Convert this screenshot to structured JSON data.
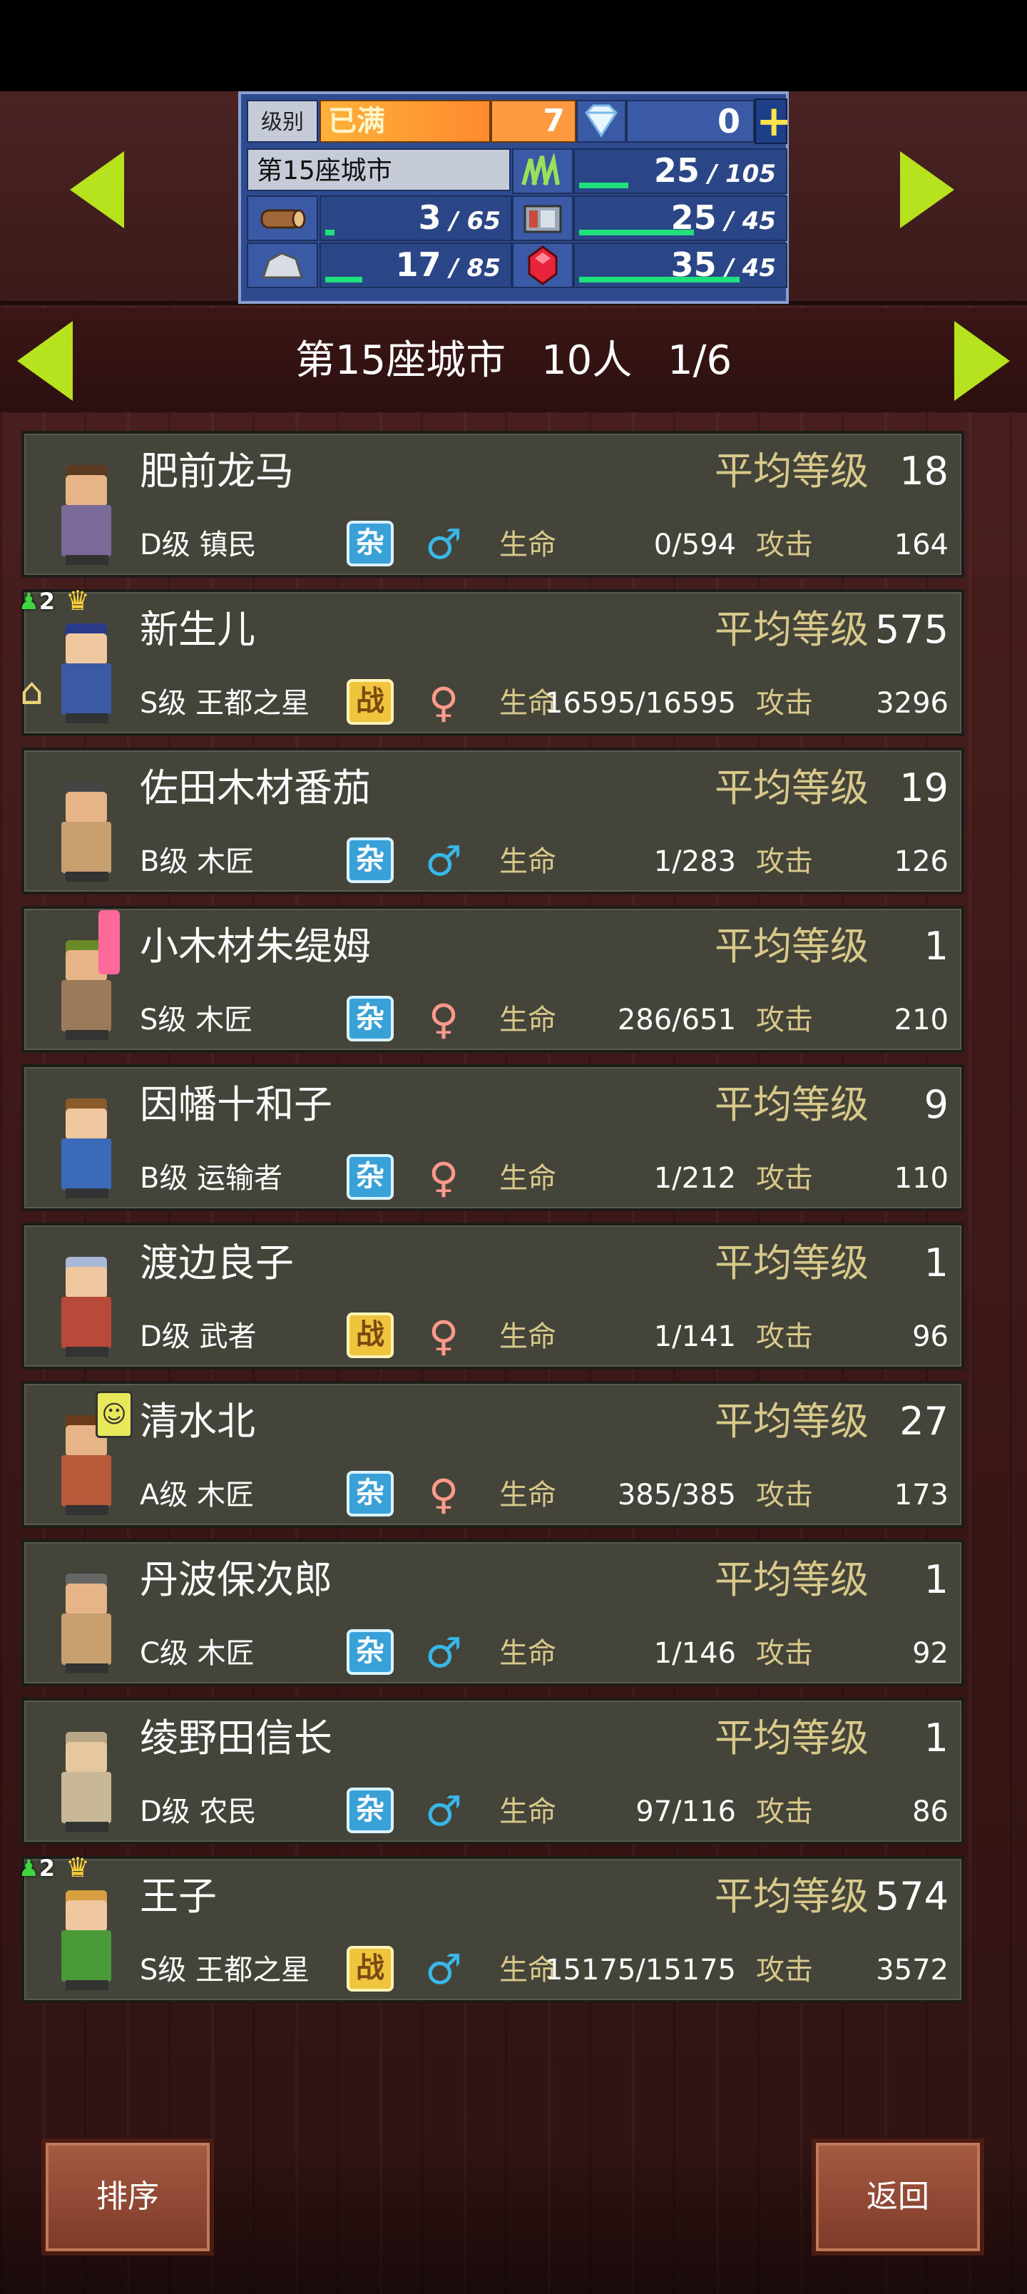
{
  "resources": {
    "level_label": "级别",
    "level_status": "已满",
    "level_value": "7",
    "gem_count": "0",
    "city_name": "第15座城市",
    "rows": [
      {
        "icon": "grass-icon",
        "value": "25",
        "cap": "105",
        "fill": 0.24,
        "color": "#1fe07a"
      },
      {
        "icon": "wood-icon",
        "value": "3",
        "cap": "65",
        "fill": 0.05,
        "color": "#1fe07a"
      },
      {
        "icon": "iron-icon",
        "value": "25",
        "cap": "45",
        "fill": 0.56,
        "color": "#1fe07a"
      },
      {
        "icon": "stone-icon",
        "value": "17",
        "cap": "85",
        "fill": 0.2,
        "color": "#1fe07a"
      },
      {
        "icon": "ruby-icon",
        "value": "35",
        "cap": "45",
        "fill": 0.78,
        "color": "#1fe07a"
      }
    ]
  },
  "header": {
    "city": "第15座城市",
    "people": "10人",
    "page": "1/6"
  },
  "labels": {
    "avg_level": "平均等级",
    "hp": "生命",
    "atk": "攻击"
  },
  "residents": [
    {
      "name": "肥前龙马",
      "level": "18",
      "rank_job": "D级 镇民",
      "type": "杂",
      "gender": "male",
      "hp": "0/594",
      "atk": "164",
      "skin": "#e6b486",
      "cloth": "#7a6a9a",
      "hair": "#5a3a22"
    },
    {
      "name": "新生儿",
      "level": "575",
      "rank_job": "S级 王都之星",
      "type": "战",
      "gender": "female",
      "hp": "16595/16595",
      "atk": "3296",
      "skin": "#f0c8a0",
      "cloth": "#3a5aa6",
      "hair": "#2a3a8a",
      "badge": "2"
    },
    {
      "name": "佐田木材番茄",
      "level": "19",
      "rank_job": "B级 木匠",
      "type": "杂",
      "gender": "male",
      "hp": "1/283",
      "atk": "126",
      "skin": "#e6b486",
      "cloth": "#c8a070",
      "hair": "#444444"
    },
    {
      "name": "小木材朱缇姆",
      "level": "1",
      "rank_job": "S级 木匠",
      "type": "杂",
      "gender": "female",
      "hp": "286/651",
      "atk": "210",
      "skin": "#e6b486",
      "cloth": "#9a7a5a",
      "hair": "#6a8a2a"
    },
    {
      "name": "因幡十和子",
      "level": "9",
      "rank_job": "B级 运输者",
      "type": "杂",
      "gender": "female",
      "hp": "1/212",
      "atk": "110",
      "skin": "#f0c8a0",
      "cloth": "#3a6ab8",
      "hair": "#8a5a2a"
    },
    {
      "name": "渡边良子",
      "level": "1",
      "rank_job": "D级 武者",
      "type": "战",
      "gender": "female",
      "hp": "1/141",
      "atk": "96",
      "skin": "#f0c8a0",
      "cloth": "#b84a3a",
      "hair": "#aab8d8"
    },
    {
      "name": "清水北",
      "level": "27",
      "rank_job": "A级 木匠",
      "type": "杂",
      "gender": "female",
      "hp": "385/385",
      "atk": "173",
      "skin": "#e6b486",
      "cloth": "#b85a3a",
      "hair": "#6a3a1a"
    },
    {
      "name": "丹波保次郎",
      "level": "1",
      "rank_job": "C级 木匠",
      "type": "杂",
      "gender": "male",
      "hp": "1/146",
      "atk": "92",
      "skin": "#e6b486",
      "cloth": "#c8a070",
      "hair": "#666666"
    },
    {
      "name": "绫野田信长",
      "level": "1",
      "rank_job": "D级 农民",
      "type": "杂",
      "gender": "male",
      "hp": "97/116",
      "atk": "86",
      "skin": "#e6c8a0",
      "cloth": "#c8b898",
      "hair": "#b8a888"
    },
    {
      "name": "王子",
      "level": "574",
      "rank_job": "S级 王都之星",
      "type": "战",
      "gender": "male",
      "hp": "15175/15175",
      "atk": "3572",
      "skin": "#f0c8a0",
      "cloth": "#4a9a3a",
      "hair": "#d8a040",
      "badge": "2"
    }
  ],
  "buttons": {
    "sort": "排序",
    "back": "返回"
  }
}
